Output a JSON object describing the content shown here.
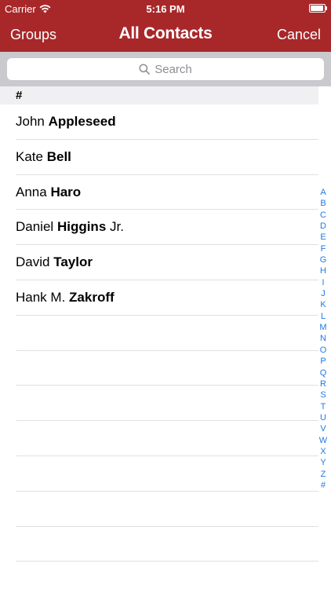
{
  "status_bar": {
    "carrier": "Carrier",
    "time": "5:16 PM"
  },
  "nav": {
    "left_label": "Groups",
    "title": "All Contacts",
    "right_label": "Cancel"
  },
  "search": {
    "placeholder": "Search"
  },
  "section": {
    "label": "#"
  },
  "contacts": [
    {
      "first": "John",
      "last": "Appleseed",
      "suffix": ""
    },
    {
      "first": "Kate",
      "last": "Bell",
      "suffix": ""
    },
    {
      "first": "Anna",
      "last": "Haro",
      "suffix": ""
    },
    {
      "first": "Daniel",
      "last": "Higgins",
      "suffix": "Jr."
    },
    {
      "first": "David",
      "last": "Taylor",
      "suffix": ""
    },
    {
      "first": "Hank M.",
      "last": "Zakroff",
      "suffix": ""
    }
  ],
  "empty_rows": 7,
  "index_letters": [
    "A",
    "B",
    "C",
    "D",
    "E",
    "F",
    "G",
    "H",
    "I",
    "J",
    "K",
    "L",
    "M",
    "N",
    "O",
    "P",
    "Q",
    "R",
    "S",
    "T",
    "U",
    "V",
    "W",
    "X",
    "Y",
    "Z",
    "#"
  ],
  "colors": {
    "nav_background": "#a8282a",
    "index_letter": "#1f7ae5",
    "search_bar_background": "#c9c9ce"
  },
  "icons": {
    "wifi": "wifi-icon",
    "battery": "battery-icon",
    "search": "search-icon"
  }
}
